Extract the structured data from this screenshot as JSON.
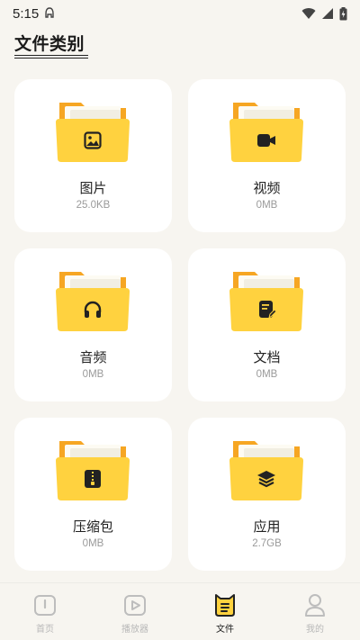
{
  "status": {
    "time": "5:15"
  },
  "page": {
    "title": "文件类别"
  },
  "categories": [
    {
      "name": "图片",
      "size": "25.0KB",
      "icon": "image-icon"
    },
    {
      "name": "视频",
      "size": "0MB",
      "icon": "video-icon"
    },
    {
      "name": "音频",
      "size": "0MB",
      "icon": "headphones-icon"
    },
    {
      "name": "文档",
      "size": "0MB",
      "icon": "document-icon"
    },
    {
      "name": "压缩包",
      "size": "0MB",
      "icon": "zip-icon"
    },
    {
      "name": "应用",
      "size": "2.7GB",
      "icon": "layers-icon"
    }
  ],
  "tabs": [
    {
      "label": "首页",
      "icon": "home-icon",
      "active": false
    },
    {
      "label": "播放器",
      "icon": "play-icon",
      "active": false
    },
    {
      "label": "文件",
      "icon": "file-icon",
      "active": true
    },
    {
      "label": "我的",
      "icon": "profile-icon",
      "active": false
    }
  ],
  "colors": {
    "accent": "#FFD23F",
    "folder_back": "#F6A623",
    "background": "#F7F5F0"
  }
}
